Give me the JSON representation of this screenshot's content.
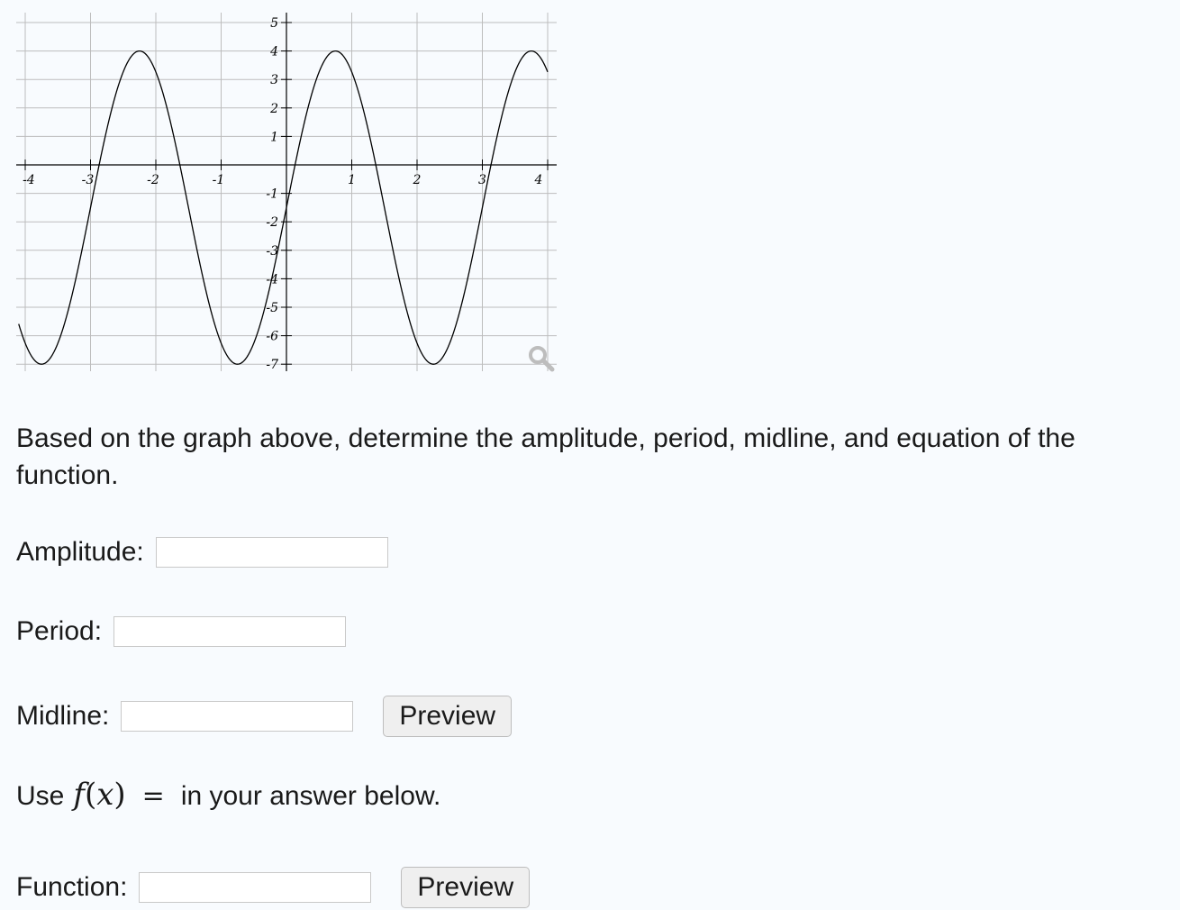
{
  "graph": {
    "x_ticks": [
      "-4",
      "-3",
      "-2",
      "-1",
      "1",
      "2",
      "3",
      "4"
    ],
    "y_ticks": [
      "5",
      "4",
      "3",
      "2",
      "1",
      "-1",
      "-2",
      "-3",
      "-4",
      "-5",
      "-6",
      "-7"
    ],
    "zoom_icon": "magnifier-icon"
  },
  "chart_data": {
    "type": "line",
    "xlim": [
      -4.1,
      4
    ],
    "ylim": [
      -7,
      5
    ],
    "grid": true,
    "series": [
      {
        "expression": "f(x) = -1.5 + 5.5*sin((2*pi/3)*x)",
        "x_range": [
          -4.1,
          4
        ]
      }
    ]
  },
  "question": {
    "prompt": "Based on the graph above, determine the amplitude, period, midline, and equation of the function."
  },
  "fields": {
    "amplitude_label": "Amplitude:",
    "period_label": "Period:",
    "midline_label": "Midline:",
    "function_label": "Function:",
    "amplitude_value": "",
    "period_value": "",
    "midline_value": "",
    "function_value": ""
  },
  "buttons": {
    "preview_midline": "Preview",
    "preview_function": "Preview"
  },
  "instruction": {
    "use_word": "Use",
    "math_f": "f",
    "math_paren_open": "(",
    "math_x": "x",
    "math_paren_close": ")",
    "math_equals": "=",
    "rest": "in your answer below."
  }
}
